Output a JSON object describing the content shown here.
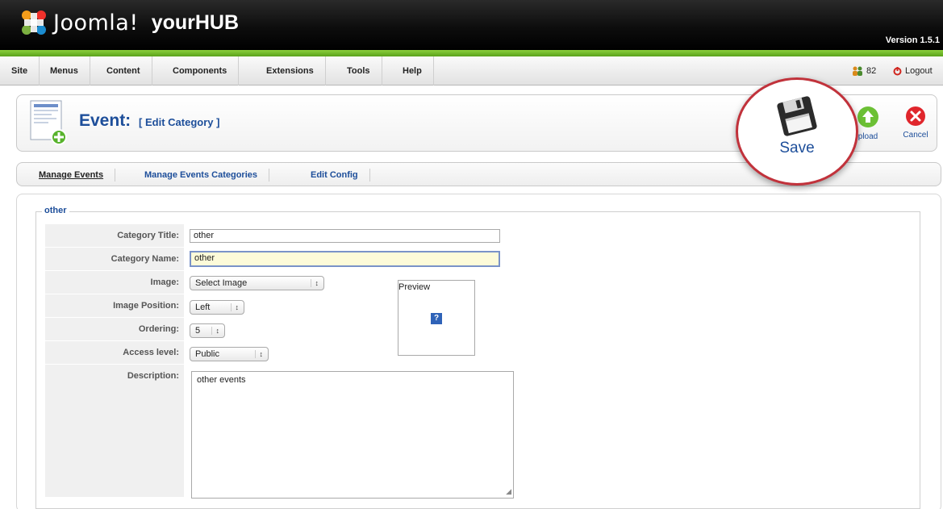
{
  "header": {
    "brand": "Joomla!",
    "product": "yourHUB",
    "version": "Version 1.5.1"
  },
  "menubar": {
    "items": [
      "Site",
      "Menus",
      "Content",
      "Components",
      "Extensions",
      "Tools",
      "Help"
    ],
    "status_count": "82",
    "logout_label": "Logout"
  },
  "toolbar": {
    "title": "Event:",
    "subtitle": "[ Edit Category ]",
    "save_label": "Save",
    "upload_label": "pload",
    "cancel_label": "Cancel"
  },
  "submenu": {
    "items": [
      "Manage Events",
      "Manage Events Categories",
      "Edit Config"
    ]
  },
  "form": {
    "legend": "other",
    "labels": {
      "category_title": "Category Title:",
      "category_name": "Category Name:",
      "image": "Image:",
      "image_position": "Image Position:",
      "ordering": "Ordering:",
      "access_level": "Access level:",
      "description": "Description:"
    },
    "values": {
      "category_title": "other",
      "category_name": "other",
      "image": "Select Image",
      "image_position": "Left",
      "ordering": "5",
      "access_level": "Public",
      "description": "other events"
    },
    "preview_label": "Preview",
    "preview_placeholder": "?"
  },
  "colors": {
    "accent_blue": "#1d4e9a",
    "header_green": "#7cc232",
    "callout_red": "#c1323b"
  }
}
